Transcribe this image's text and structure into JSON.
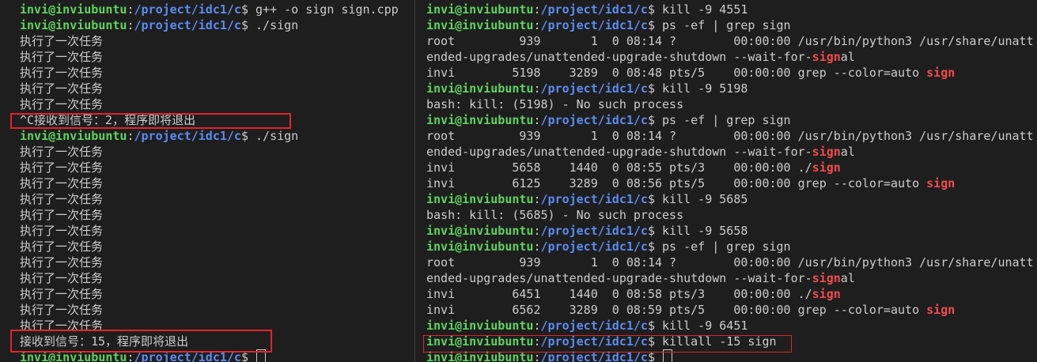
{
  "colors": {
    "background": "#1e1e1e",
    "text": "#cccccc",
    "user_host": "#5fd35f",
    "path": "#5c8cf2",
    "grep_match": "#f14c4c",
    "highlight_box": "#e0242c"
  },
  "left_terminal": {
    "lines": [
      {
        "segs": [
          {
            "t": "invi@inviubuntu",
            "c": "user"
          },
          {
            "t": ":"
          },
          {
            "t": "/project/idc1/c",
            "c": "path"
          },
          {
            "t": "$ g++ -o sign sign.cpp"
          }
        ]
      },
      {
        "segs": [
          {
            "t": "invi@inviubuntu",
            "c": "user"
          },
          {
            "t": ":"
          },
          {
            "t": "/project/idc1/c",
            "c": "path"
          },
          {
            "t": "$ ./sign"
          }
        ]
      },
      {
        "segs": [
          {
            "t": "执行了一次任务"
          }
        ]
      },
      {
        "segs": [
          {
            "t": "执行了一次任务"
          }
        ]
      },
      {
        "segs": [
          {
            "t": "执行了一次任务"
          }
        ]
      },
      {
        "segs": [
          {
            "t": "执行了一次任务"
          }
        ]
      },
      {
        "segs": [
          {
            "t": "执行了一次任务"
          }
        ]
      },
      {
        "segs": [
          {
            "t": "^C接收到信号：2，程序即将退出"
          }
        ]
      },
      {
        "segs": [
          {
            "t": "invi@inviubuntu",
            "c": "user"
          },
          {
            "t": ":"
          },
          {
            "t": "/project/idc1/c",
            "c": "path"
          },
          {
            "t": "$ ./sign"
          }
        ]
      },
      {
        "segs": [
          {
            "t": "执行了一次任务"
          }
        ]
      },
      {
        "segs": [
          {
            "t": "执行了一次任务"
          }
        ]
      },
      {
        "segs": [
          {
            "t": "执行了一次任务"
          }
        ]
      },
      {
        "segs": [
          {
            "t": "执行了一次任务"
          }
        ]
      },
      {
        "segs": [
          {
            "t": "执行了一次任务"
          }
        ]
      },
      {
        "segs": [
          {
            "t": "执行了一次任务"
          }
        ]
      },
      {
        "segs": [
          {
            "t": "执行了一次任务"
          }
        ]
      },
      {
        "segs": [
          {
            "t": "执行了一次任务"
          }
        ]
      },
      {
        "segs": [
          {
            "t": "执行了一次任务"
          }
        ]
      },
      {
        "segs": [
          {
            "t": "执行了一次任务"
          }
        ]
      },
      {
        "segs": [
          {
            "t": "执行了一次任务"
          }
        ]
      },
      {
        "segs": [
          {
            "t": "执行了一次任务"
          }
        ]
      },
      {
        "segs": [
          {
            "t": "接收到信号：15，程序即将退出"
          }
        ]
      },
      {
        "segs": [
          {
            "t": "invi@inviubuntu",
            "c": "user"
          },
          {
            "t": ":"
          },
          {
            "t": "/project/idc1/c",
            "c": "path"
          },
          {
            "t": "$ "
          }
        ],
        "cursor": true
      }
    ]
  },
  "right_terminal": {
    "lines": [
      {
        "segs": [
          {
            "t": "invi@inviubuntu",
            "c": "user"
          },
          {
            "t": ":"
          },
          {
            "t": "/project/idc1/c",
            "c": "path"
          },
          {
            "t": "$ kill -9 4551"
          }
        ]
      },
      {
        "segs": [
          {
            "t": "invi@inviubuntu",
            "c": "user"
          },
          {
            "t": ":"
          },
          {
            "t": "/project/idc1/c",
            "c": "path"
          },
          {
            "t": "$ ps -ef | grep sign"
          }
        ]
      },
      {
        "segs": [
          {
            "t": "root         939       1  0 08:14 ?        00:00:00 /usr/bin/python3 /usr/share/unatt"
          }
        ]
      },
      {
        "segs": [
          {
            "t": "ended-upgrades/unattended-upgrade-shutdown --wait-for-"
          },
          {
            "t": "sign",
            "c": "match"
          },
          {
            "t": "al"
          }
        ]
      },
      {
        "segs": [
          {
            "t": "invi        5198    3289  0 08:48 pts/5    00:00:00 grep --color=auto "
          },
          {
            "t": "sign",
            "c": "match"
          }
        ]
      },
      {
        "segs": [
          {
            "t": "invi@inviubuntu",
            "c": "user"
          },
          {
            "t": ":"
          },
          {
            "t": "/project/idc1/c",
            "c": "path"
          },
          {
            "t": "$ kill -9 5198"
          }
        ]
      },
      {
        "segs": [
          {
            "t": "bash: kill: (5198) - No such process"
          }
        ]
      },
      {
        "segs": [
          {
            "t": "invi@inviubuntu",
            "c": "user"
          },
          {
            "t": ":"
          },
          {
            "t": "/project/idc1/c",
            "c": "path"
          },
          {
            "t": "$ ps -ef | grep sign"
          }
        ]
      },
      {
        "segs": [
          {
            "t": "root         939       1  0 08:14 ?        00:00:00 /usr/bin/python3 /usr/share/unatt"
          }
        ]
      },
      {
        "segs": [
          {
            "t": "ended-upgrades/unattended-upgrade-shutdown --wait-for-"
          },
          {
            "t": "sign",
            "c": "match"
          },
          {
            "t": "al"
          }
        ]
      },
      {
        "segs": [
          {
            "t": "invi        5658    1440  0 08:55 pts/3    00:00:00 ./"
          },
          {
            "t": "sign",
            "c": "match"
          }
        ]
      },
      {
        "segs": [
          {
            "t": "invi        6125    3289  0 08:56 pts/5    00:00:00 grep --color=auto "
          },
          {
            "t": "sign",
            "c": "match"
          }
        ]
      },
      {
        "segs": [
          {
            "t": "invi@inviubuntu",
            "c": "user"
          },
          {
            "t": ":"
          },
          {
            "t": "/project/idc1/c",
            "c": "path"
          },
          {
            "t": "$ kill -9 5685"
          }
        ]
      },
      {
        "segs": [
          {
            "t": "bash: kill: (5685) - No such process"
          }
        ]
      },
      {
        "segs": [
          {
            "t": "invi@inviubuntu",
            "c": "user"
          },
          {
            "t": ":"
          },
          {
            "t": "/project/idc1/c",
            "c": "path"
          },
          {
            "t": "$ kill -9 5658"
          }
        ]
      },
      {
        "segs": [
          {
            "t": "invi@inviubuntu",
            "c": "user"
          },
          {
            "t": ":"
          },
          {
            "t": "/project/idc1/c",
            "c": "path"
          },
          {
            "t": "$ ps -ef | grep sign"
          }
        ]
      },
      {
        "segs": [
          {
            "t": "root         939       1  0 08:14 ?        00:00:00 /usr/bin/python3 /usr/share/unatt"
          }
        ]
      },
      {
        "segs": [
          {
            "t": "ended-upgrades/unattended-upgrade-shutdown --wait-for-"
          },
          {
            "t": "sign",
            "c": "match"
          },
          {
            "t": "al"
          }
        ]
      },
      {
        "segs": [
          {
            "t": "invi        6451    1440  0 08:58 pts/3    00:00:00 ./"
          },
          {
            "t": "sign",
            "c": "match"
          }
        ]
      },
      {
        "segs": [
          {
            "t": "invi        6562    3289  0 08:59 pts/5    00:00:00 grep --color=auto "
          },
          {
            "t": "sign",
            "c": "match"
          }
        ]
      },
      {
        "segs": [
          {
            "t": "invi@inviubuntu",
            "c": "user"
          },
          {
            "t": ":"
          },
          {
            "t": "/project/idc1/c",
            "c": "path"
          },
          {
            "t": "$ kill -9 6451"
          }
        ]
      },
      {
        "segs": [
          {
            "t": "invi@inviubuntu",
            "c": "user"
          },
          {
            "t": ":"
          },
          {
            "t": "/project/idc1/c",
            "c": "path"
          },
          {
            "t": "$ killall -15 sign"
          }
        ]
      },
      {
        "segs": [
          {
            "t": "invi@inviubuntu",
            "c": "user"
          },
          {
            "t": ":"
          },
          {
            "t": "/project/idc1/c",
            "c": "path"
          },
          {
            "t": "$ "
          }
        ],
        "cursor": true
      }
    ]
  }
}
